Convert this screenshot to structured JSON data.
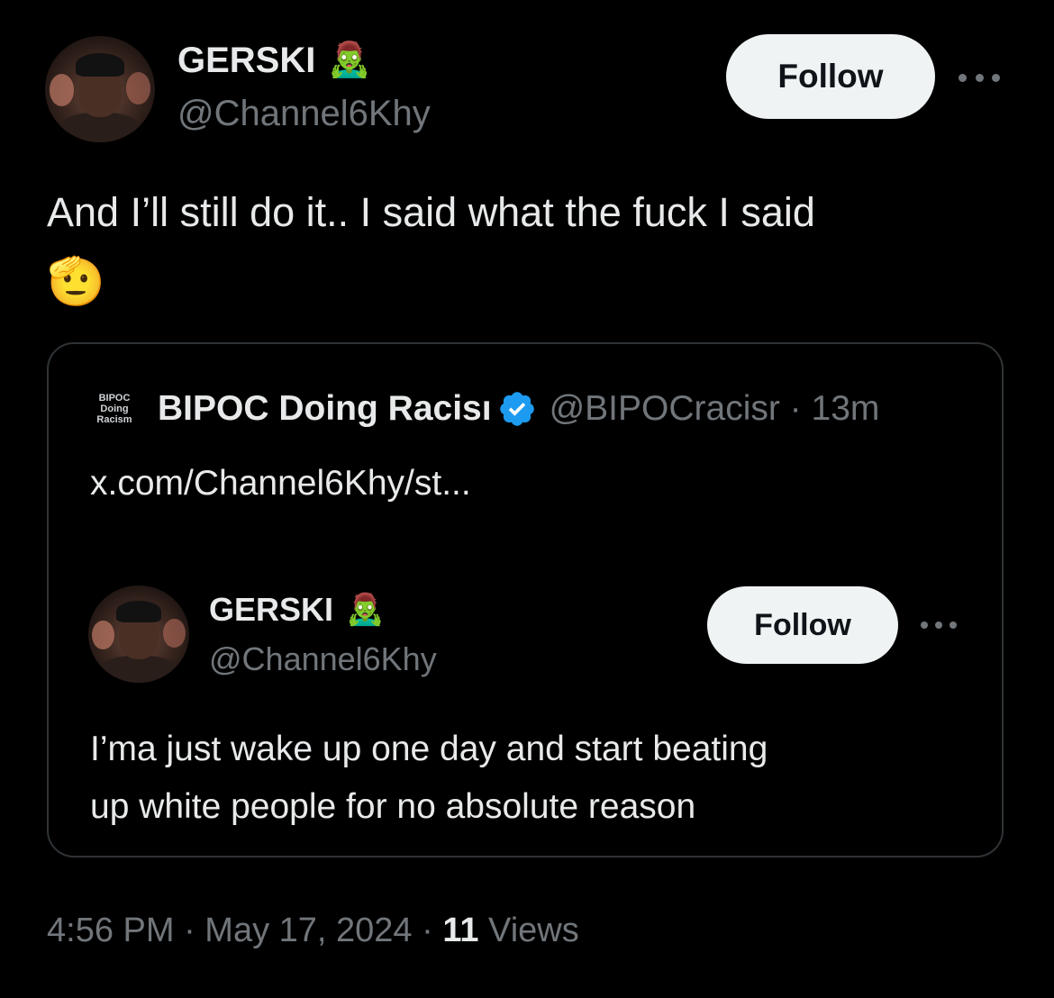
{
  "tweet": {
    "author": {
      "display_name": "GERSKI",
      "name_emoji": "🧟‍♂️",
      "handle": "@Channel6Khy"
    },
    "follow_label": "Follow",
    "text": "And I’ll still do it.. I said what the fuck I said",
    "text_emoji": "🫡",
    "timestamp": "4:56 PM · May 17, 2024 · ",
    "views_count": "11",
    "views_label": " Views"
  },
  "quote": {
    "logo_text": "BIPOC Doing Racism",
    "display_name": "BIPOC Doing Racisı",
    "handle_time": "@BIPOCracisr · 13m",
    "link_text": "x.com/Channel6Khy/st...",
    "embedded": {
      "display_name": "GERSKI",
      "name_emoji": "🧟‍♂️",
      "handle": "@Channel6Khy",
      "follow_label": "Follow",
      "text_line1": "I’ma just wake up one day and start beating",
      "text_line2": "up white people for no absolute reason"
    }
  },
  "colors": {
    "background": "#000000",
    "primary_text": "#e7e9ea",
    "secondary_text": "#71767b",
    "border": "#2f3336",
    "follow_bg": "#eff3f4",
    "verified_blue": "#1d9bf0"
  },
  "icons": {
    "more": "more-horizontal-icon",
    "verified": "verified-badge-icon"
  }
}
